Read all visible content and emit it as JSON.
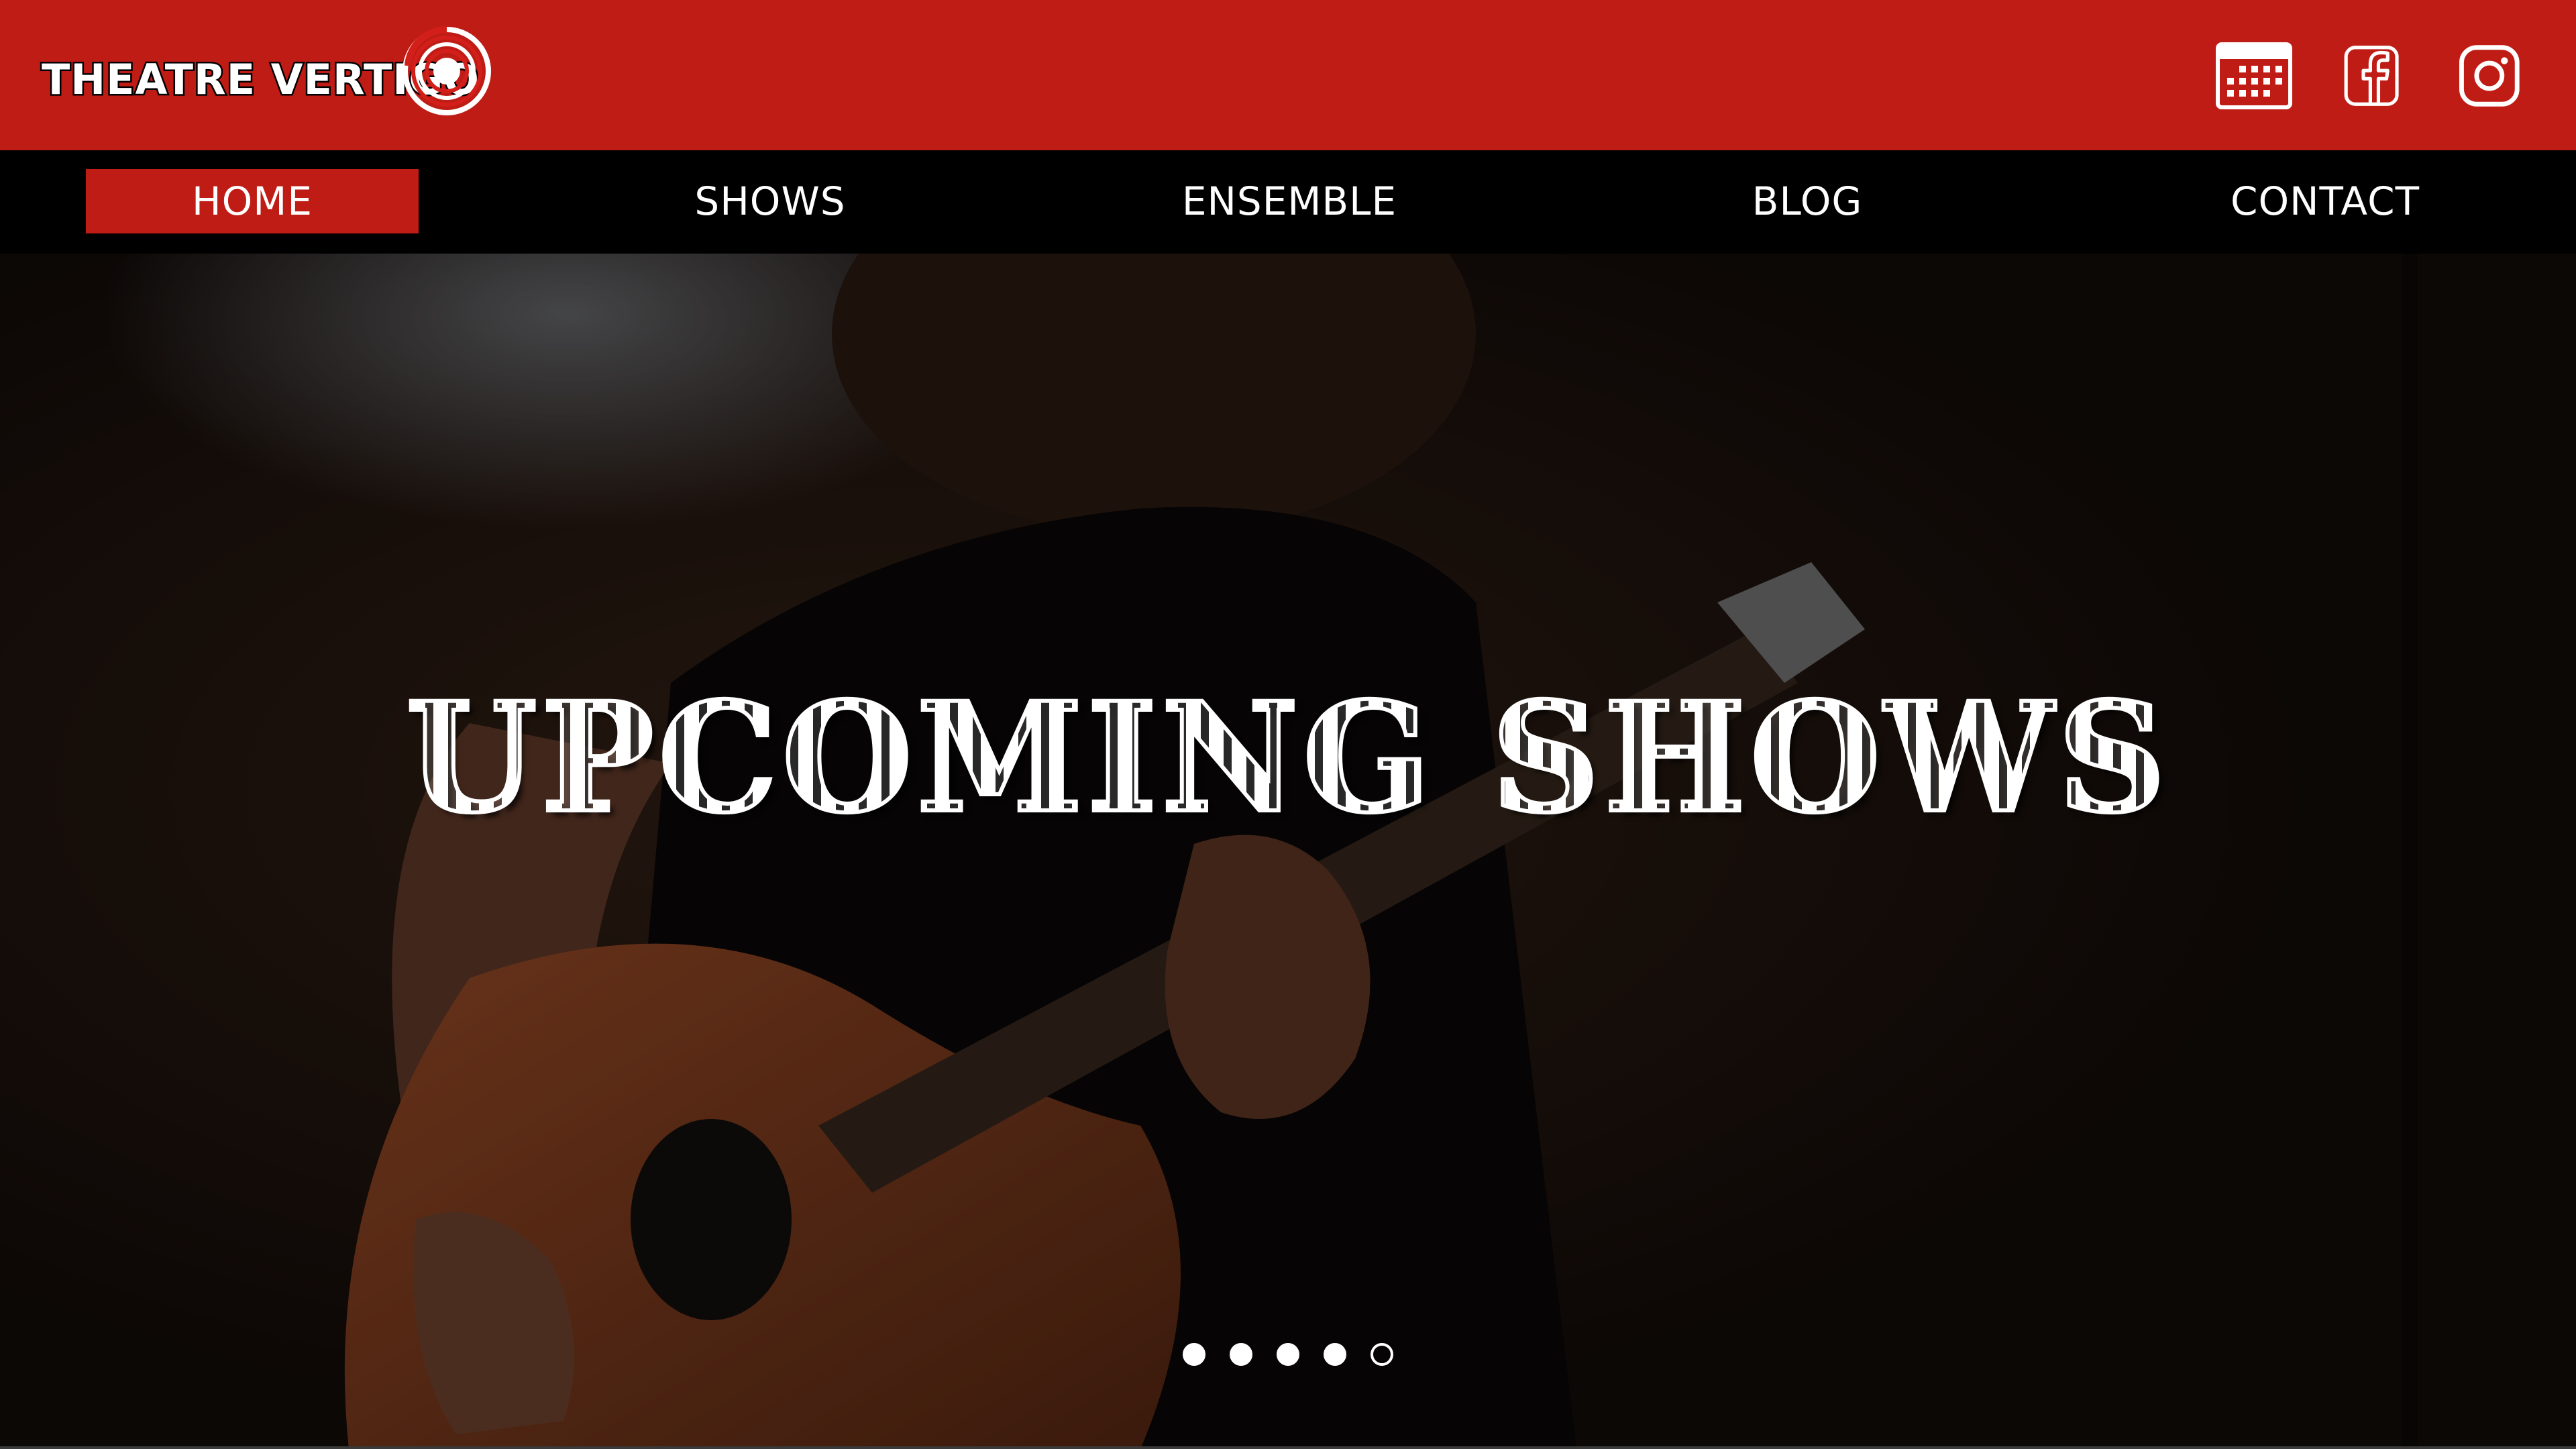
{
  "header": {
    "logo_text": "THEATRE VERTIGO",
    "brand_color": "#bf1c16",
    "icons": [
      "calendar-icon",
      "facebook-icon",
      "instagram-icon"
    ]
  },
  "nav": {
    "items": [
      {
        "label": "HOME",
        "active": true
      },
      {
        "label": "SHOWS",
        "active": false
      },
      {
        "label": "ENSEMBLE",
        "active": false
      },
      {
        "label": "BLOG",
        "active": false
      },
      {
        "label": "CONTACT",
        "active": false
      }
    ]
  },
  "hero": {
    "title": "UPCOMING SHOWS",
    "slide_count": 5,
    "current_slide": 5
  }
}
